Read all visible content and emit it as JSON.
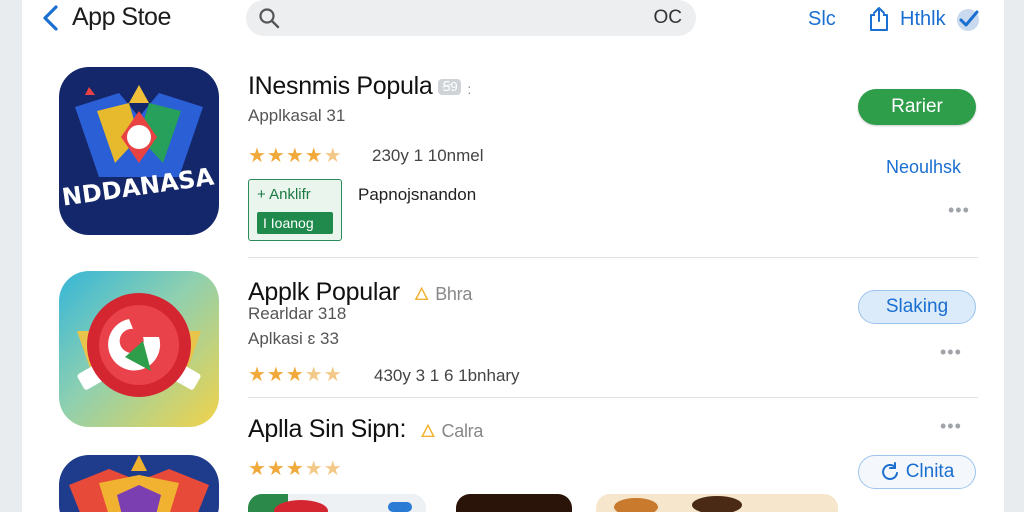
{
  "topbar": {
    "back_label": "App Stoe",
    "search_glyph": "OC",
    "link_label": "Slc",
    "right_label": "Hthlk"
  },
  "apps": [
    {
      "title": "INesnmis Popula",
      "title_badge": "Ꞩ9",
      "title_tail": ":",
      "subtitle": "Applkasal 31",
      "rating_text": "230y 1 10nmel",
      "icon_text": "NDDANASA",
      "tag_top": "+ Anklifr",
      "tag_bottom": "I Ioanog",
      "tag_desc": "Papnojsnandon",
      "button_label": "Rarier",
      "side_link": "Neoulhsk",
      "stars": 4.5
    },
    {
      "title": "Applk Popular",
      "title_tag": "Bhra",
      "subtitle": "Rearldar 318",
      "subtitle2": "Aplkasi ɛ 33",
      "rating_text": "430y 3 1 6 1bnhary",
      "button_label": "Slaking",
      "stars": 3.5
    },
    {
      "title": "Aplla Sin Sipn:",
      "title_tag": "Calra",
      "button_label": "Clnita",
      "stars": 3.5
    }
  ],
  "colors": {
    "accent": "#1a6fd1",
    "green": "#2e9e4a",
    "star": "#f0a93a"
  },
  "icons": {
    "back": "chevron-left-icon",
    "search": "magnifier-icon",
    "share": "share-icon",
    "badge": "checkmark-badge-icon"
  }
}
